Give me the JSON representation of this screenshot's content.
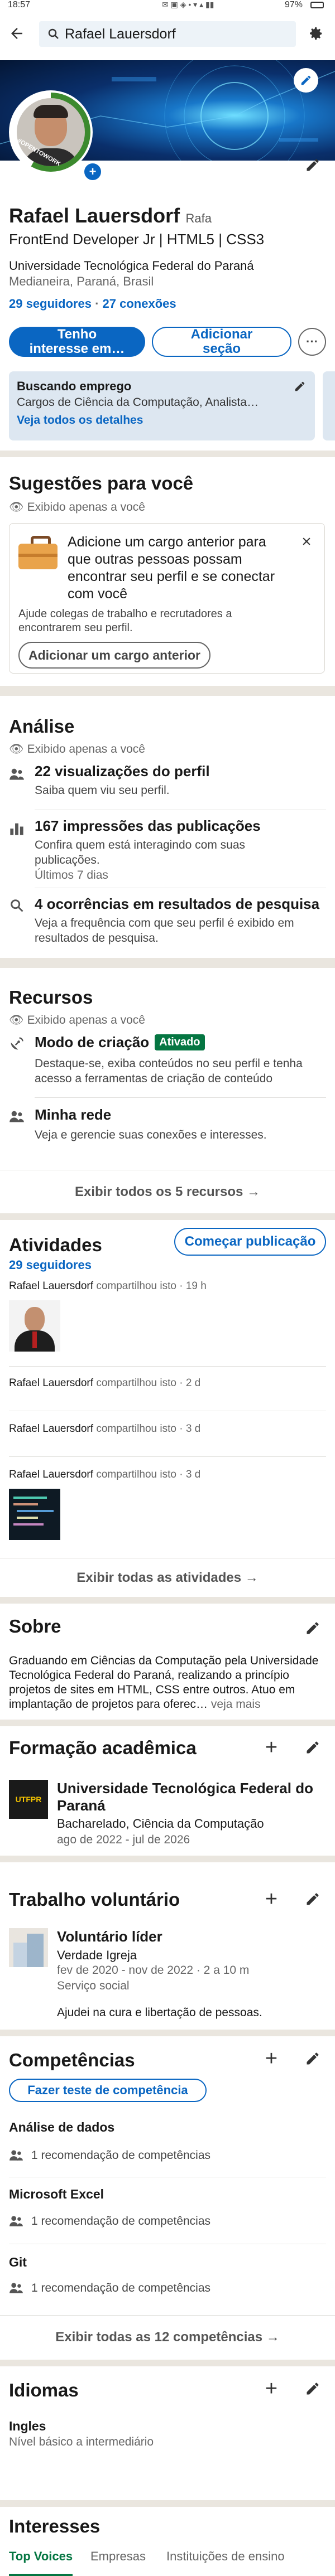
{
  "status_bar": {
    "time": "18:57",
    "battery": "97%"
  },
  "search": {
    "query": "Rafael Lauersdorf"
  },
  "profile": {
    "badge": "#OPENTOWORK",
    "name": "Rafael Lauersdorf",
    "pronoun": "Rafa",
    "headline": "FrontEnd Developer Jr | HTML5 | CSS3",
    "education": "Universidade Tecnológica Federal do Paraná",
    "location": "Medianeira, Paraná, Brasil",
    "followers": "29 seguidores",
    "connections": "27 conexões",
    "btn_interest": "Tenho interesse em…",
    "btn_add_section": "Adicionar seção",
    "job_search": {
      "title": "Buscando emprego",
      "roles": "Cargos de Ciência da Computação, Analista…",
      "details_link": "Veja todos os detalhes"
    }
  },
  "suggestions": {
    "title": "Sugestões para você",
    "visibility": "Exibido apenas a você",
    "card_title": "Adicione um cargo anterior para que outras pessoas possam encontrar seu perfil e se conectar com você",
    "card_desc": "Ajude colegas de trabalho e recrutadores a encontrarem seu perfil.",
    "card_button": "Adicionar um cargo anterior"
  },
  "analytics": {
    "title": "Análise",
    "visibility": "Exibido apenas a você",
    "items": [
      {
        "title": "22 visualizações do perfil",
        "desc": "Saiba quem viu seu perfil.",
        "extra": ""
      },
      {
        "title": "167 impressões das publicações",
        "desc": "Confira quem está interagindo com suas publicações.",
        "extra": "Últimos 7 dias"
      },
      {
        "title": "4 ocorrências em resultados de pesquisa",
        "desc": "Veja a frequência com que seu perfil é exibido em resultados de pesquisa.",
        "extra": ""
      }
    ]
  },
  "resources": {
    "title": "Recursos",
    "visibility": "Exibido apenas a você",
    "items": [
      {
        "title": "Modo de criação",
        "badge": "Ativado",
        "desc": "Destaque-se, exiba conteúdos no seu perfil e tenha acesso a ferramentas de criação de conteúdo"
      },
      {
        "title": "Minha rede",
        "badge": "",
        "desc": "Veja e gerencie suas conexões e interesses."
      }
    ],
    "show_all": "Exibir todos os 5 recursos →"
  },
  "activities": {
    "title": "Atividades",
    "followers": "29 seguidores",
    "start_post": "Começar publicação",
    "posts": [
      {
        "author": "Rafael Lauersdorf",
        "action": "compartilhou isto · 19 h"
      },
      {
        "author": "Rafael Lauersdorf",
        "action": "compartilhou isto · 2 d"
      },
      {
        "author": "Rafael Lauersdorf",
        "action": "compartilhou isto · 3 d"
      },
      {
        "author": "Rafael Lauersdorf",
        "action": "compartilhou isto · 3 d"
      }
    ],
    "show_all": "Exibir todas as atividades →"
  },
  "about": {
    "title": "Sobre",
    "text": "Graduando em Ciências da Computação pela Universidade Tecnológica Federal do Paraná, realizando a princípio projetos de sites em HTML, CSS entre outros. Atuo em implantação de projetos para oferec…",
    "more": "veja mais"
  },
  "education": {
    "title": "Formação acadêmica",
    "logo": "UTFPR",
    "school": "Universidade Tecnológica Federal do Paraná",
    "degree": "Bacharelado, Ciência da Computação",
    "dates": "ago de 2022 - jul de 2026"
  },
  "volunteer": {
    "title": "Trabalho voluntário",
    "role": "Voluntário líder",
    "org": "Verdade Igreja",
    "dates": "fev de 2020 - nov de 2022 · 2 a 10 m",
    "cause": "Serviço social",
    "desc": "Ajudei na cura e libertação de pessoas."
  },
  "skills": {
    "title": "Competências",
    "test_button": "Fazer teste de competência",
    "items": [
      {
        "name": "Análise de dados",
        "endorse": "1 recomendação de competências"
      },
      {
        "name": "Microsoft Excel",
        "endorse": "1 recomendação de competências"
      },
      {
        "name": "Git",
        "endorse": "1 recomendação de competências"
      }
    ],
    "show_all": "Exibir todas as 12 competências →"
  },
  "languages": {
    "title": "Idiomas",
    "name": "Ingles",
    "level": "Nível básico a intermediário"
  },
  "interests": {
    "title": "Interesses",
    "tabs": [
      "Top Voices",
      "Empresas",
      "Instituições de ensino"
    ]
  },
  "colors": {
    "brand": "#0a66c2",
    "green": "#057642",
    "bg": "#eae6df"
  }
}
